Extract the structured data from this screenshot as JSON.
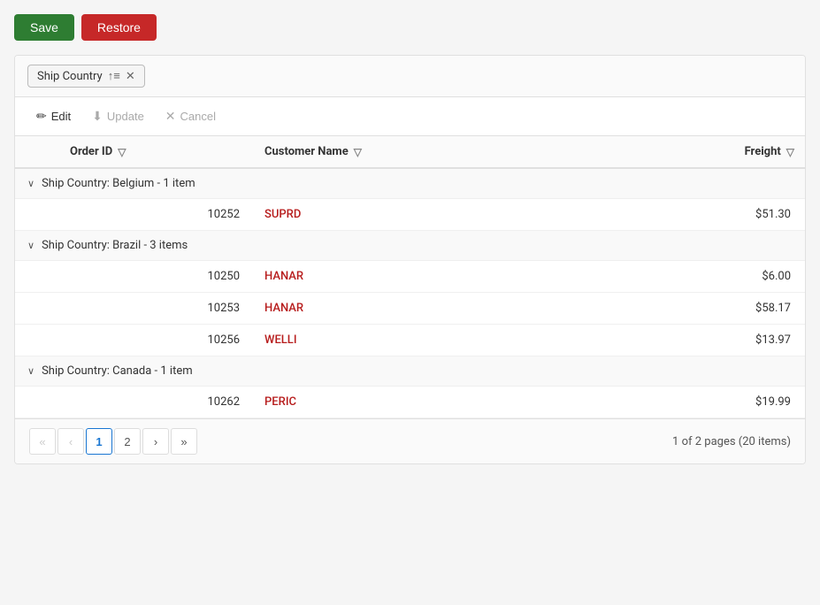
{
  "toolbar": {
    "save_label": "Save",
    "restore_label": "Restore"
  },
  "group_tag_bar": {
    "tag_label": "Ship Country",
    "sort_icon": "↑≡",
    "close_icon": "✕"
  },
  "action_bar": {
    "edit_label": "Edit",
    "update_label": "Update",
    "cancel_label": "Cancel"
  },
  "columns": [
    {
      "label": "",
      "key": "expand"
    },
    {
      "label": "Order ID",
      "key": "order_id",
      "filterable": true
    },
    {
      "label": "Customer Name",
      "key": "customer_name",
      "filterable": true
    },
    {
      "label": "Freight",
      "key": "freight",
      "filterable": true
    }
  ],
  "groups": [
    {
      "label": "Ship Country: Belgium - 1 item",
      "expanded": true,
      "rows": [
        {
          "order_id": "10252",
          "customer_name": "SUPRD",
          "freight": "$51.30"
        }
      ]
    },
    {
      "label": "Ship Country: Brazil - 3 items",
      "expanded": true,
      "rows": [
        {
          "order_id": "10250",
          "customer_name": "HANAR",
          "freight": "$6.00"
        },
        {
          "order_id": "10253",
          "customer_name": "HANAR",
          "freight": "$58.17"
        },
        {
          "order_id": "10256",
          "customer_name": "WELLI",
          "freight": "$13.97"
        }
      ]
    },
    {
      "label": "Ship Country: Canada - 1 item",
      "expanded": true,
      "rows": [
        {
          "order_id": "10262",
          "customer_name": "PERIC",
          "freight": "$19.99"
        }
      ]
    }
  ],
  "pagination": {
    "pages": [
      "1",
      "2"
    ],
    "active_page": "1",
    "summary": "1 of 2 pages (20 items)",
    "first_label": "«",
    "prev_label": "‹",
    "next_label": "›",
    "last_label": "»"
  }
}
